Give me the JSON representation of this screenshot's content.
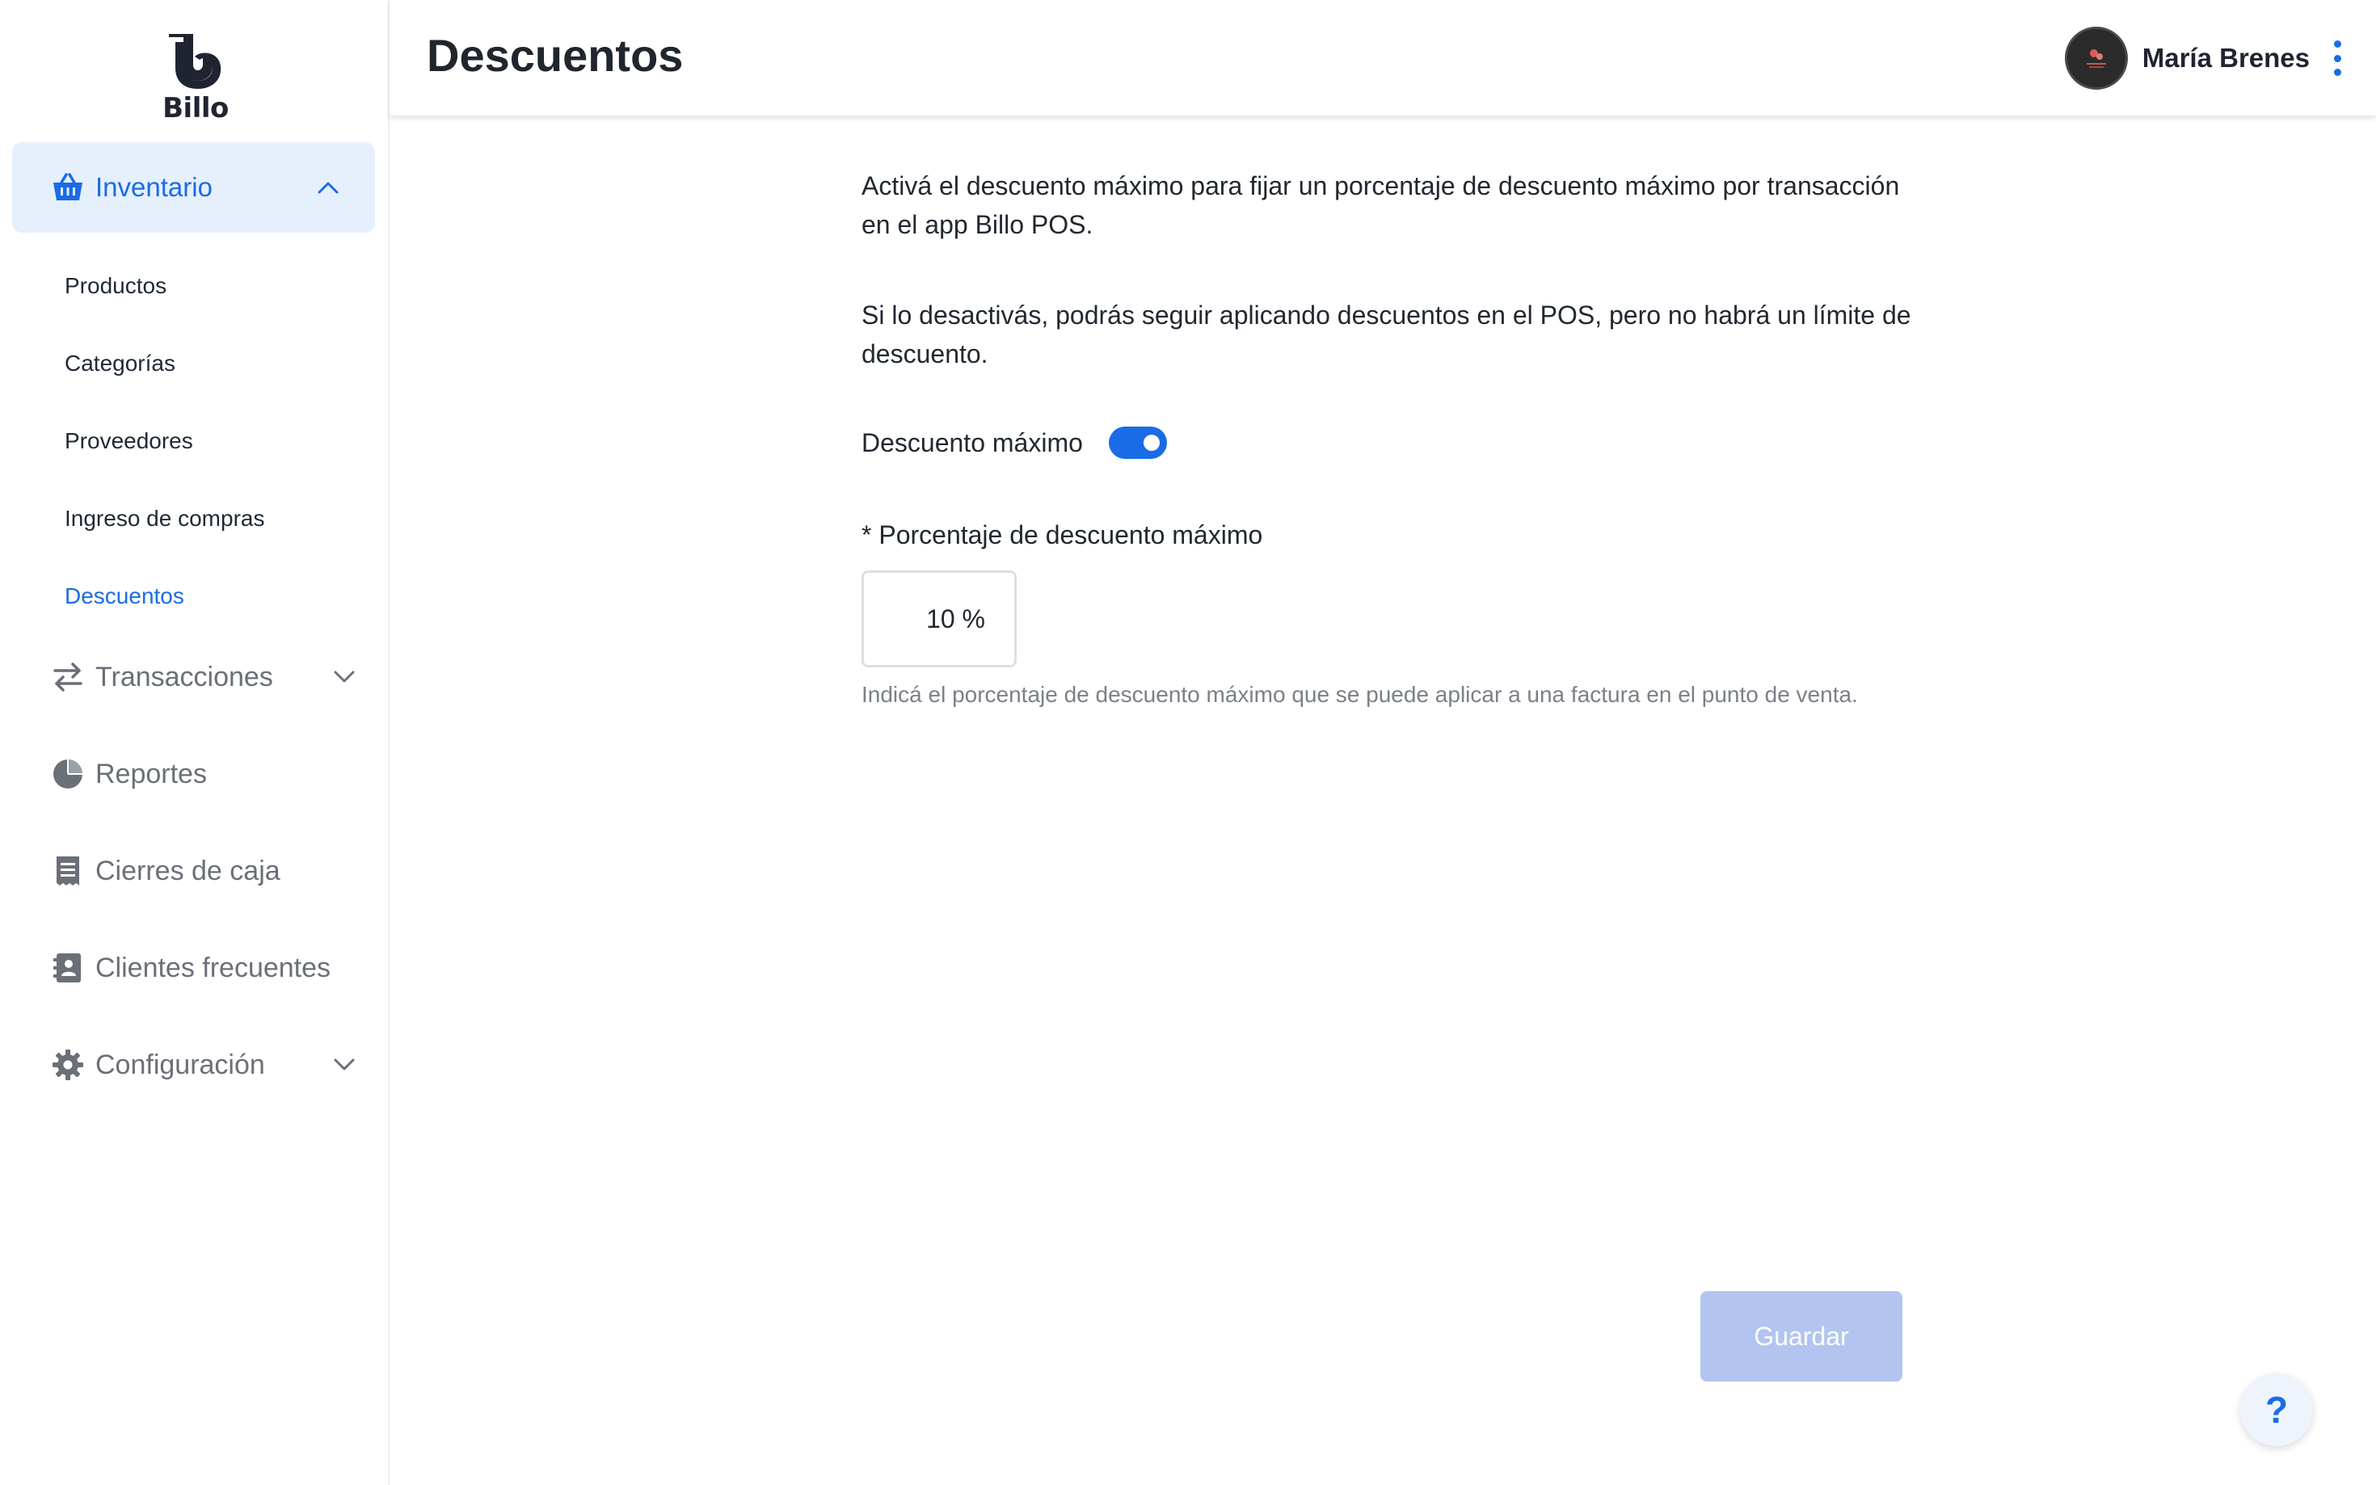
{
  "app": {
    "logo_text": "Billo"
  },
  "header": {
    "title": "Descuentos",
    "user_name": "María Brenes"
  },
  "sidebar": {
    "inventario": {
      "label": "Inventario",
      "items": [
        {
          "label": "Productos"
        },
        {
          "label": "Categorías"
        },
        {
          "label": "Proveedores"
        },
        {
          "label": "Ingreso de compras"
        },
        {
          "label": "Descuentos"
        }
      ]
    },
    "items": [
      {
        "label": "Transacciones",
        "icon": "arrows-swap-icon"
      },
      {
        "label": "Reportes",
        "icon": "pie-chart-icon"
      },
      {
        "label": "Cierres de caja",
        "icon": "receipt-icon"
      },
      {
        "label": "Clientes frecuentes",
        "icon": "contact-book-icon"
      },
      {
        "label": "Configuración",
        "icon": "gear-icon"
      }
    ]
  },
  "main": {
    "paragraph1": "Activá el descuento máximo para fijar un porcentaje de descuento máximo por transacción en el app Billo POS.",
    "paragraph2": "Si lo desactivás, podrás seguir aplicando descuentos en el POS, pero no habrá un límite de descuento.",
    "toggle_label": "Descuento máximo",
    "toggle_on": true,
    "field_label": "* Porcentaje de descuento máximo",
    "field_value": "10 %",
    "hint": "Indicá el porcentaje de descuento máximo que se puede aplicar a una factura en el punto de venta.",
    "save_label": "Guardar"
  },
  "help": {
    "label": "?"
  },
  "colors": {
    "accent": "#1a6ce6",
    "active_bg": "#e6f0fd",
    "disabled_button": "#b3c4f0"
  }
}
